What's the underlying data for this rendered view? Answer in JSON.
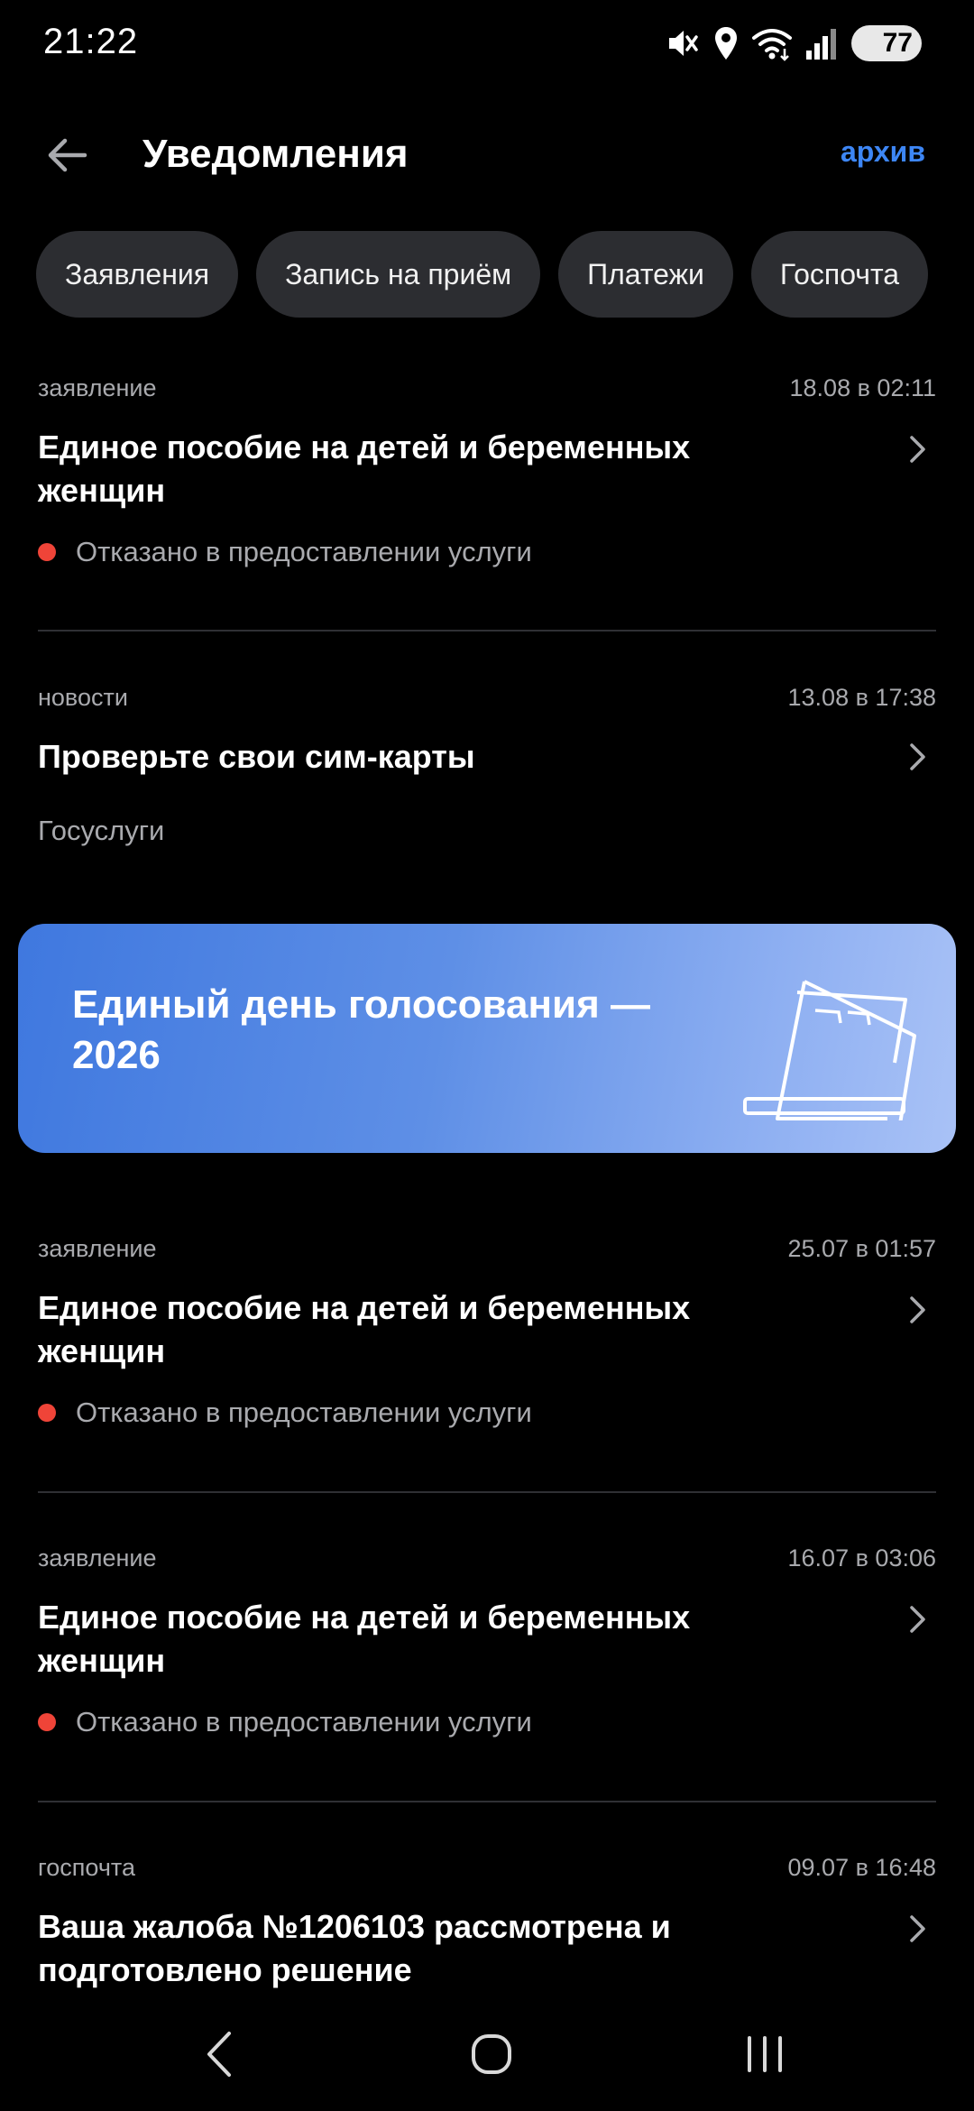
{
  "status_bar": {
    "time": "21:22",
    "battery": "77",
    "icons": [
      "mute-icon",
      "location-icon",
      "wifi-icon",
      "signal-icon",
      "battery-icon"
    ]
  },
  "header": {
    "title": "Уведомления",
    "archive_label": "архив",
    "accent_color": "#3d86f5"
  },
  "filters": [
    {
      "label": "Заявления"
    },
    {
      "label": "Запись на приём"
    },
    {
      "label": "Платежи"
    },
    {
      "label": "Госпочта"
    }
  ],
  "notifications": [
    {
      "category": "заявление",
      "datetime": "18.08 в 02:11",
      "title": "Единое пособие на детей и беременных женщин",
      "status": "Отказано в предоставлении услуги",
      "status_color": "#ef4438"
    },
    {
      "category": "новости",
      "datetime": "13.08 в 17:38",
      "title": "Проверьте свои сим-карты",
      "source": "Госуслуги"
    },
    {
      "category": "заявление",
      "datetime": "25.07 в 01:57",
      "title": "Единое пособие на детей и беременных женщин",
      "status": "Отказано в предоставлении услуги",
      "status_color": "#ef4438"
    },
    {
      "category": "заявление",
      "datetime": "16.07 в 03:06",
      "title": "Единое пособие на детей и беременных женщин",
      "status": "Отказано в предоставлении услуги",
      "status_color": "#ef4438"
    },
    {
      "category": "госпочта",
      "datetime": "09.07 в 16:48",
      "title": "Ваша жалоба №1206103 рассмотрена и подготовлено решение"
    }
  ],
  "banner": {
    "title": "Единый день голосования — 2026",
    "icon": "ballot-box-icon"
  },
  "nav_bar": {
    "icons": [
      "back-nav-icon",
      "home-nav-icon",
      "recents-nav-icon"
    ]
  }
}
